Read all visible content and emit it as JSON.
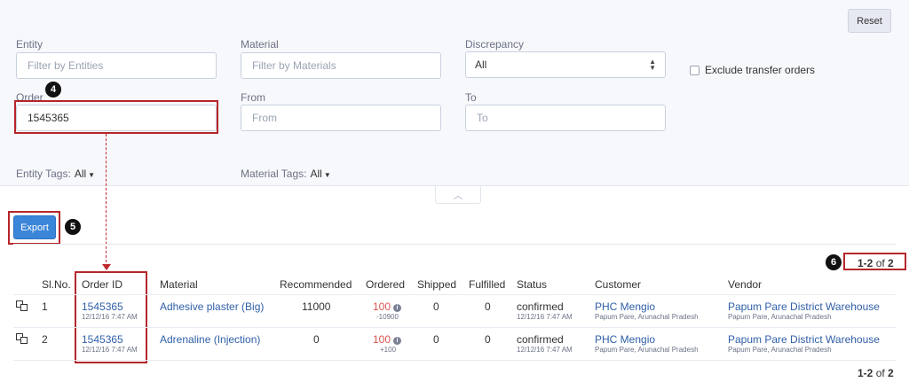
{
  "filters": {
    "reset_label": "Reset",
    "entity": {
      "label": "Entity",
      "placeholder": "Filter by Entities"
    },
    "material": {
      "label": "Material",
      "placeholder": "Filter by Materials"
    },
    "discrepancy": {
      "label": "Discrepancy",
      "value": "All"
    },
    "exclude_transfer": {
      "label": "Exclude transfer orders"
    },
    "order": {
      "label": "Order",
      "value": "1545365"
    },
    "from": {
      "label": "From",
      "placeholder": "From"
    },
    "to": {
      "label": "To",
      "placeholder": "To"
    },
    "entity_tags": {
      "label": "Entity Tags:",
      "value": "All"
    },
    "material_tags": {
      "label": "Material Tags:",
      "value": "All"
    }
  },
  "toolbar": {
    "export_label": "Export"
  },
  "annotations": {
    "step4": "4",
    "step5": "5",
    "step6": "6"
  },
  "pager": {
    "range": "1-2",
    "of": "of",
    "total": "2"
  },
  "table": {
    "headers": {
      "slno": "Sl.No.",
      "order_id": "Order ID",
      "material": "Material",
      "recommended": "Recommended",
      "ordered": "Ordered",
      "shipped": "Shipped",
      "fulfilled": "Fulfilled",
      "status": "Status",
      "customer": "Customer",
      "vendor": "Vendor"
    },
    "rows": [
      {
        "slno": "1",
        "order_id": "1545365",
        "order_time": "12/12/16 7:47 AM",
        "material": "Adhesive plaster (Big)",
        "recommended": "11000",
        "ordered": "100",
        "ordered_diff": "-10900",
        "shipped": "0",
        "fulfilled": "0",
        "status": "confirmed",
        "status_time": "12/12/16 7:47 AM",
        "customer": "PHC Mengio",
        "customer_loc": "Papum Pare, Arunachal Pradesh",
        "vendor": "Papum Pare District Warehouse",
        "vendor_loc": "Papum Pare, Arunachal Pradesh"
      },
      {
        "slno": "2",
        "order_id": "1545365",
        "order_time": "12/12/16 7:47 AM",
        "material": "Adrenaline (Injection)",
        "recommended": "0",
        "ordered": "100",
        "ordered_diff": "+100",
        "shipped": "0",
        "fulfilled": "0",
        "status": "confirmed",
        "status_time": "12/12/16 7:47 AM",
        "customer": "PHC Mengio",
        "customer_loc": "Papum Pare, Arunachal Pradesh",
        "vendor": "Papum Pare District Warehouse",
        "vendor_loc": "Papum Pare, Arunachal Pradesh"
      }
    ]
  },
  "colors": {
    "accent": "#3b86d8",
    "link": "#2f5fa8",
    "annotation": "#b5262a",
    "discrepancy": "#d9534f"
  }
}
